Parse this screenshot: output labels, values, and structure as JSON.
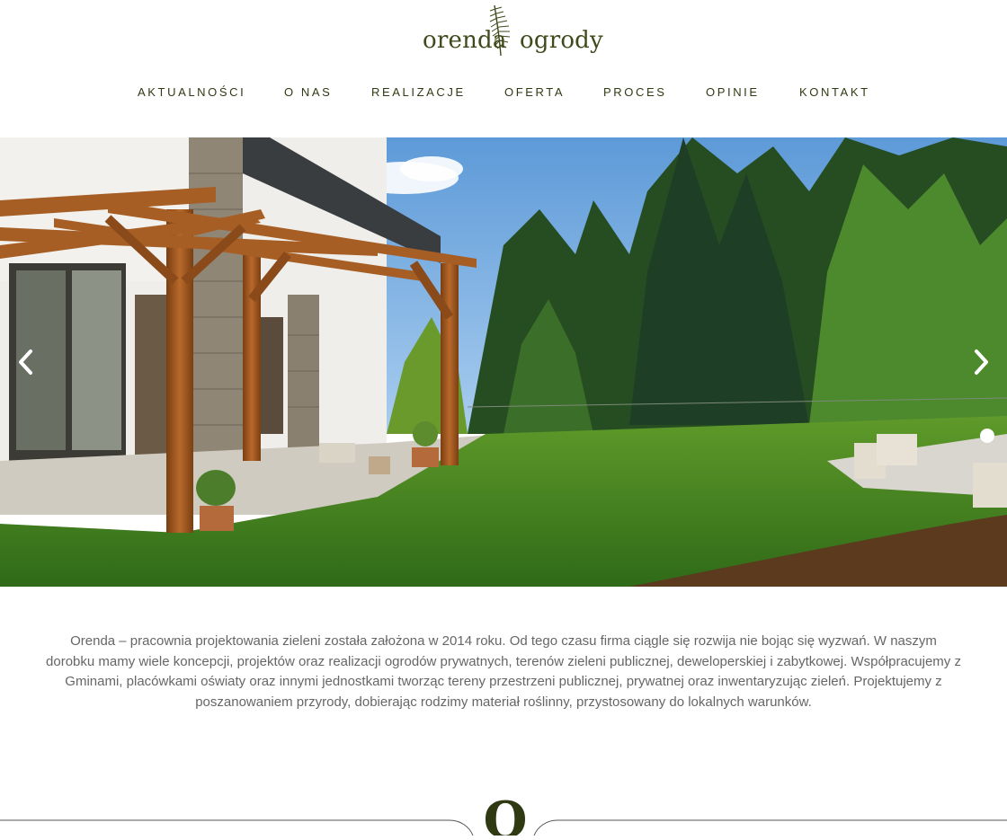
{
  "brand": {
    "logo_word_1": "orenda",
    "logo_word_2": "ogrody",
    "logo_color": "#3e4a1a",
    "divider_letter": "O"
  },
  "nav": {
    "items": [
      {
        "label": "AKTUALNOŚCI"
      },
      {
        "label": "O NAS"
      },
      {
        "label": "REALIZACJE"
      },
      {
        "label": "OFERTA"
      },
      {
        "label": "PROCES"
      },
      {
        "label": "OPINIE"
      },
      {
        "label": "KONTAKT"
      }
    ]
  },
  "slider": {
    "prev_icon": "chevron-left-icon",
    "next_icon": "chevron-right-icon"
  },
  "intro": {
    "text": "Orenda – pracownia projektowania zieleni została założona w 2014 roku. Od tego czasu firma ciągle się rozwija nie bojąc się wyzwań. W naszym dorobku mamy wiele koncepcji, projektów oraz realizacji ogrodów prywatnych, terenów zieleni publicznej, deweloperskiej i zabytkowej. Współpracujemy z Gminami, placówkami oświaty oraz innymi jednostkami tworząc tereny przestrzeni publicznej, prywatnej oraz inwentaryzując zieleń. Projektujemy z poszanowaniem przyrody, dobierając rodzimy materiał roślinny, przystosowany do lokalnych warunków."
  }
}
